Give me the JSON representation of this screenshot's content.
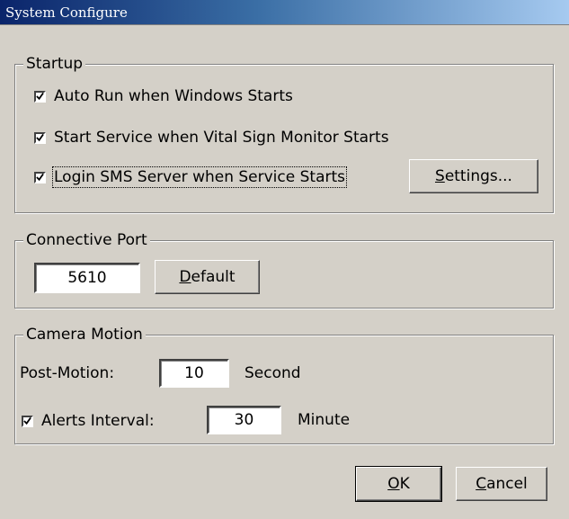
{
  "window": {
    "title": "System Configure"
  },
  "startup": {
    "legend": "Startup",
    "auto_run": {
      "label": "Auto Run when Windows Starts",
      "checked": true
    },
    "start_service": {
      "label": "Start Service when Vital Sign Monitor Starts",
      "checked": true
    },
    "login_sms": {
      "label": "Login SMS Server when Service Starts",
      "checked": true
    },
    "settings_button": {
      "mnemonic": "S",
      "rest": "ettings..."
    }
  },
  "connective_port": {
    "legend": "Connective Port",
    "port_value": "5610",
    "default_button": {
      "mnemonic": "D",
      "rest": "efault"
    }
  },
  "camera_motion": {
    "legend": "Camera Motion",
    "post_motion_label": "Post-Motion:",
    "post_motion_value": "10",
    "post_motion_unit": "Second",
    "alerts_interval": {
      "label": "Alerts Interval:",
      "checked": true
    },
    "alerts_interval_value": "30",
    "alerts_interval_unit": "Minute"
  },
  "footer": {
    "ok_button": {
      "mnemonic": "O",
      "rest": "K"
    },
    "cancel_button": {
      "mnemonic": "C",
      "rest": "ancel"
    }
  }
}
